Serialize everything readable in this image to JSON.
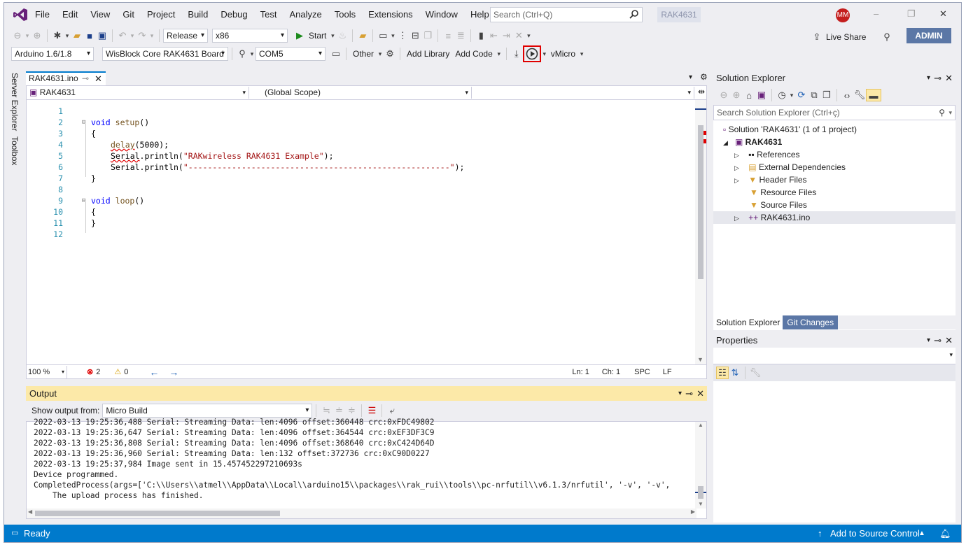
{
  "title_bar": {
    "logo": "visual-studio-logo",
    "menu": [
      "File",
      "Edit",
      "View",
      "Git",
      "Project",
      "Build",
      "Debug",
      "Test",
      "Analyze",
      "Tools",
      "Extensions",
      "Window",
      "Help"
    ],
    "search_placeholder": "Search (Ctrl+Q)",
    "project": "RAK4631",
    "avatar": "MM",
    "controls": [
      "–",
      "❐",
      "✕"
    ]
  },
  "toolbar1": {
    "configuration": "Release",
    "platform": "x86",
    "start": "Start",
    "live_share": "Live Share",
    "admin": "ADMIN"
  },
  "toolbar2": {
    "board_version": "Arduino 1.6/1.8",
    "board": "WisBlock Core RAK4631 Board",
    "port": "COM5",
    "other": "Other",
    "add_library": "Add Library",
    "add_code": "Add Code",
    "vmicro": "vMicro"
  },
  "sidebar": {
    "tabs": [
      "Server Explorer",
      "Toolbox"
    ]
  },
  "editor": {
    "tab": "RAK4631.ino",
    "nav": {
      "project": "RAK4631",
      "scope": "(Global Scope)",
      "member": ""
    },
    "lines": [
      "1",
      "2",
      "3",
      "4",
      "5",
      "6",
      "7",
      "8",
      "9",
      "10",
      "11",
      "12"
    ],
    "code": {
      "l2a": "void",
      "l2b": "setup",
      "l2c": "()",
      "l3": "{",
      "l4a": "delay",
      "l4b": "(5000);",
      "l5a": "Serial",
      "l5b": ".println(",
      "l5c": "\"RAKwireless RAK4631 Example\"",
      "l5d": ");",
      "l6a": "Serial",
      "l6b": ".println(",
      "l6c": "\"------------------------------------------------------\"",
      "l6d": ");",
      "l7": "}",
      "l9a": "void",
      "l9b": "loop",
      "l9c": "()",
      "l10": "{",
      "l11": "}"
    },
    "status": {
      "zoom": "100 %",
      "errors": "2",
      "warnings": "0",
      "ln": "Ln: 1",
      "ch": "Ch: 1",
      "spc": "SPC",
      "lf": "LF"
    }
  },
  "output": {
    "title": "Output",
    "show_from_label": "Show output from:",
    "source": "Micro Build",
    "lines": [
      "2022-03-13 19:25:36,488 Serial: Streaming Data: len:4096 offset:360448 crc:0xFDC49802",
      "2022-03-13 19:25:36,647 Serial: Streaming Data: len:4096 offset:364544 crc:0xEF3DF3C9",
      "2022-03-13 19:25:36,808 Serial: Streaming Data: len:4096 offset:368640 crc:0xC424D64D",
      "2022-03-13 19:25:36,960 Serial: Streaming Data: len:132 offset:372736 crc:0xC90D0227",
      "2022-03-13 19:25:37,984 Image sent in 15.457452297210693s",
      "Device programmed.",
      "CompletedProcess(args=['C:\\\\Users\\\\atmel\\\\AppData\\\\Local\\\\arduino15\\\\packages\\\\rak_rui\\\\tools\\\\pc-nrfutil\\\\v6.1.3/nrfutil', '-v', '-v',",
      "    The upload process has finished."
    ]
  },
  "solution": {
    "title": "Solution Explorer",
    "search_placeholder": "Search Solution Explorer (Ctrl+ç)",
    "nodes": [
      "Solution 'RAK4631' (1 of 1 project)",
      "RAK4631",
      "References",
      "External Dependencies",
      "Header Files",
      "Resource Files",
      "Source Files",
      "RAK4631.ino"
    ],
    "tabs": [
      "Solution Explorer",
      "Git Changes"
    ]
  },
  "properties": {
    "title": "Properties"
  },
  "status": {
    "ready": "Ready",
    "source_control": "Add to Source Control"
  }
}
